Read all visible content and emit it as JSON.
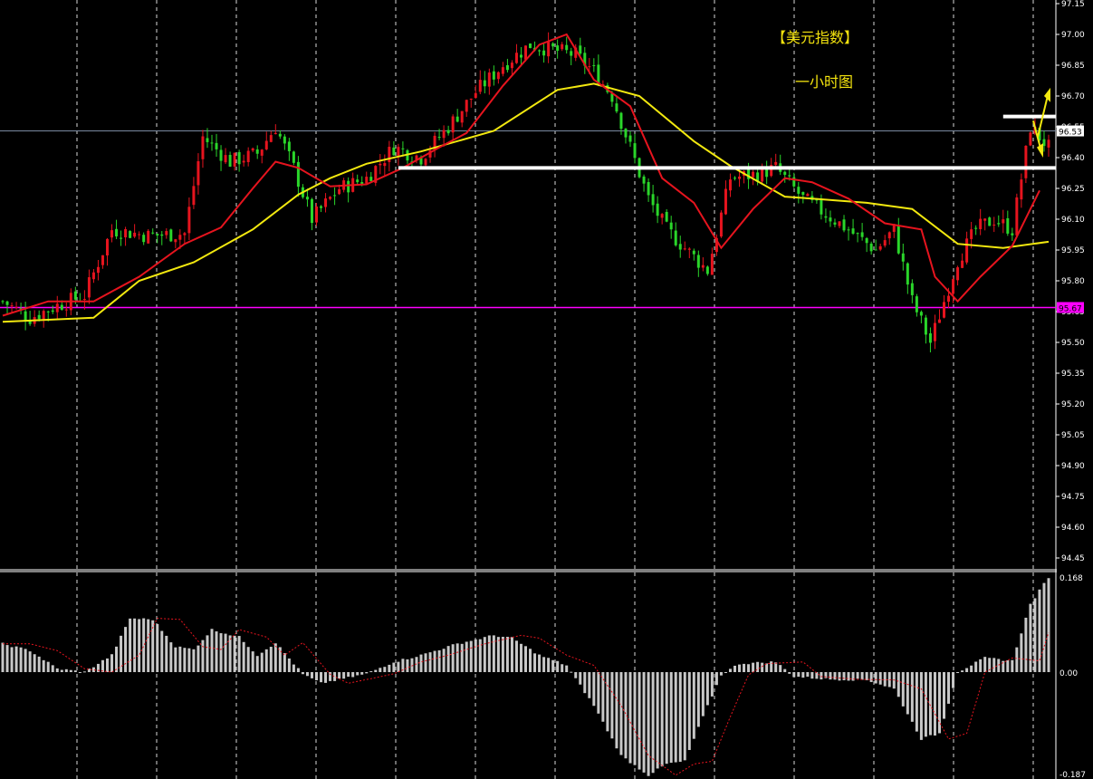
{
  "chart_data": {
    "type": "candlestick",
    "title": "【美元指数】",
    "subtitle": "一小时图",
    "colors": {
      "background": "#000000",
      "up": "#e6141e",
      "down": "#2ad62a",
      "ma_fast": "#e6141e",
      "ma_slow": "#f2e80f",
      "grid": "#ffffff",
      "axis_text": "#ffffff",
      "support_line": "#ff00ff",
      "levels": "#ffffff",
      "arrows": "#f2e80f",
      "histogram": "#c8c8c8",
      "signal": "#e6141e"
    },
    "price_axis": {
      "ticks": [
        "97.15",
        "97.00",
        "96.85",
        "96.70",
        "96.55",
        "96.40",
        "96.25",
        "96.10",
        "95.95",
        "95.80",
        "95.65",
        "95.50",
        "95.35",
        "95.20",
        "95.05",
        "94.90",
        "94.75",
        "94.60",
        "94.45"
      ],
      "range": [
        94.4,
        97.17
      ],
      "current_price_label": "96.53",
      "current_price": 96.53,
      "support_label": "95.67",
      "support_price": 95.67
    },
    "horizontal_levels": [
      {
        "price": 96.35,
        "from_index": 87,
        "to_index": 230
      },
      {
        "price": 96.6,
        "from_index": 220,
        "to_index": 230
      }
    ],
    "ma_fast_points": [
      [
        0,
        95.63
      ],
      [
        10,
        95.7
      ],
      [
        20,
        95.7
      ],
      [
        30,
        95.82
      ],
      [
        40,
        95.98
      ],
      [
        48,
        96.06
      ],
      [
        55,
        96.25
      ],
      [
        60,
        96.38
      ],
      [
        65,
        96.35
      ],
      [
        72,
        96.26
      ],
      [
        80,
        96.27
      ],
      [
        88,
        96.35
      ],
      [
        96,
        96.45
      ],
      [
        102,
        96.52
      ],
      [
        110,
        96.75
      ],
      [
        118,
        96.95
      ],
      [
        124,
        97.0
      ],
      [
        130,
        96.78
      ],
      [
        138,
        96.65
      ],
      [
        145,
        96.3
      ],
      [
        152,
        96.18
      ],
      [
        158,
        95.96
      ],
      [
        165,
        96.15
      ],
      [
        172,
        96.3
      ],
      [
        178,
        96.28
      ],
      [
        186,
        96.2
      ],
      [
        194,
        96.08
      ],
      [
        202,
        96.05
      ],
      [
        205,
        95.82
      ],
      [
        210,
        95.7
      ],
      [
        215,
        95.82
      ],
      [
        222,
        95.97
      ],
      [
        228,
        96.24
      ]
    ],
    "ma_slow_points": [
      [
        0,
        95.6
      ],
      [
        20,
        95.62
      ],
      [
        30,
        95.8
      ],
      [
        42,
        95.89
      ],
      [
        55,
        96.05
      ],
      [
        65,
        96.22
      ],
      [
        72,
        96.3
      ],
      [
        80,
        96.37
      ],
      [
        92,
        96.43
      ],
      [
        108,
        96.53
      ],
      [
        122,
        96.73
      ],
      [
        130,
        96.76
      ],
      [
        140,
        96.7
      ],
      [
        152,
        96.48
      ],
      [
        160,
        96.36
      ],
      [
        172,
        96.21
      ],
      [
        178,
        96.2
      ],
      [
        190,
        96.18
      ],
      [
        200,
        96.15
      ],
      [
        210,
        95.98
      ],
      [
        220,
        95.96
      ],
      [
        230,
        95.99
      ]
    ],
    "candle_anchors": [
      [
        0,
        95.7
      ],
      [
        6,
        95.62
      ],
      [
        12,
        95.68
      ],
      [
        18,
        95.73
      ],
      [
        24,
        96.05
      ],
      [
        32,
        96.02
      ],
      [
        40,
        96.03
      ],
      [
        44,
        96.5
      ],
      [
        50,
        96.38
      ],
      [
        56,
        96.42
      ],
      [
        60,
        96.55
      ],
      [
        64,
        96.35
      ],
      [
        68,
        96.1
      ],
      [
        74,
        96.25
      ],
      [
        80,
        96.3
      ],
      [
        86,
        96.45
      ],
      [
        92,
        96.4
      ],
      [
        98,
        96.55
      ],
      [
        104,
        96.72
      ],
      [
        110,
        96.85
      ],
      [
        116,
        96.95
      ],
      [
        122,
        96.92
      ],
      [
        126,
        96.9
      ],
      [
        130,
        96.82
      ],
      [
        134,
        96.7
      ],
      [
        138,
        96.45
      ],
      [
        142,
        96.2
      ],
      [
        146,
        96.05
      ],
      [
        150,
        95.96
      ],
      [
        155,
        95.85
      ],
      [
        160,
        96.3
      ],
      [
        166,
        96.32
      ],
      [
        170,
        96.35
      ],
      [
        176,
        96.2
      ],
      [
        184,
        96.08
      ],
      [
        192,
        95.95
      ],
      [
        196,
        96.05
      ],
      [
        200,
        95.7
      ],
      [
        204,
        95.5
      ],
      [
        210,
        95.9
      ],
      [
        214,
        96.05
      ],
      [
        218,
        96.1
      ],
      [
        222,
        96.05
      ],
      [
        226,
        96.55
      ],
      [
        230,
        96.45
      ]
    ],
    "histogram_anchors": [
      [
        0,
        0.05
      ],
      [
        6,
        0.038
      ],
      [
        12,
        0.006
      ],
      [
        18,
        0.0
      ],
      [
        24,
        0.03
      ],
      [
        28,
        0.095
      ],
      [
        33,
        0.093
      ],
      [
        38,
        0.045
      ],
      [
        42,
        0.04
      ],
      [
        46,
        0.075
      ],
      [
        52,
        0.062
      ],
      [
        56,
        0.03
      ],
      [
        60,
        0.052
      ],
      [
        66,
        -0.004
      ],
      [
        70,
        -0.02
      ],
      [
        76,
        -0.01
      ],
      [
        80,
        -0.003
      ],
      [
        86,
        0.018
      ],
      [
        92,
        0.03
      ],
      [
        100,
        0.05
      ],
      [
        108,
        0.065
      ],
      [
        112,
        0.06
      ],
      [
        118,
        0.03
      ],
      [
        124,
        0.012
      ],
      [
        130,
        -0.06
      ],
      [
        136,
        -0.15
      ],
      [
        142,
        -0.185
      ],
      [
        146,
        -0.165
      ],
      [
        150,
        -0.16
      ],
      [
        154,
        -0.08
      ],
      [
        158,
        -0.005
      ],
      [
        162,
        0.015
      ],
      [
        170,
        0.018
      ],
      [
        174,
        -0.008
      ],
      [
        182,
        -0.013
      ],
      [
        190,
        -0.014
      ],
      [
        196,
        -0.03
      ],
      [
        202,
        -0.12
      ],
      [
        206,
        -0.11
      ],
      [
        210,
        0.0
      ],
      [
        216,
        0.025
      ],
      [
        222,
        0.02
      ],
      [
        226,
        0.12
      ],
      [
        230,
        0.168
      ]
    ],
    "macd_axis": {
      "ticks": [
        "0.168",
        "0.00",
        "-0.187"
      ],
      "range": [
        -0.187,
        0.168
      ]
    }
  }
}
